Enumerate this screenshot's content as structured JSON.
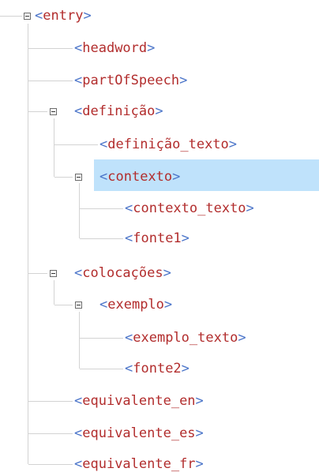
{
  "tree": {
    "nodes": [
      {
        "id": "entry",
        "label": "entry",
        "expanded": true
      },
      {
        "id": "headword",
        "label": "headword"
      },
      {
        "id": "partOfSpeech",
        "label": "partOfSpeech"
      },
      {
        "id": "definicao",
        "label": "definição",
        "expanded": true
      },
      {
        "id": "definicao_texto",
        "label": "definição_texto"
      },
      {
        "id": "contexto",
        "label": "contexto",
        "expanded": true,
        "selected": true
      },
      {
        "id": "contexto_texto",
        "label": "contexto_texto"
      },
      {
        "id": "fonte1",
        "label": "fonte1"
      },
      {
        "id": "colocacoes",
        "label": "colocações",
        "expanded": true
      },
      {
        "id": "exemplo",
        "label": "exemplo",
        "expanded": true
      },
      {
        "id": "exemplo_texto",
        "label": "exemplo_texto"
      },
      {
        "id": "fonte2",
        "label": "fonte2"
      },
      {
        "id": "equivalente_en",
        "label": "equivalente_en"
      },
      {
        "id": "equivalente_es",
        "label": "equivalente_es"
      },
      {
        "id": "equivalente_fr",
        "label": "equivalente_fr"
      }
    ]
  },
  "colors": {
    "bracket": "#4a74c9",
    "tag_name": "#b22d2d",
    "selection": "#bfe2fb",
    "guide_line": "#d3d3d3"
  },
  "icons": {
    "toggle": "collapse-minus-icon"
  }
}
